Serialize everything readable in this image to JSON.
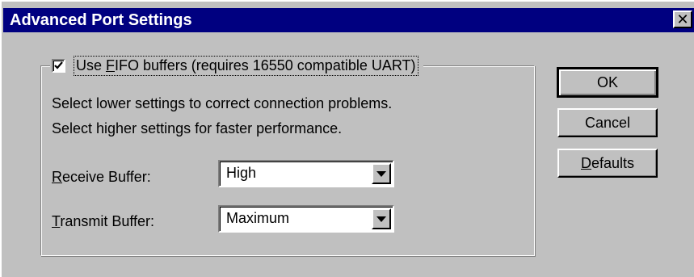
{
  "window": {
    "title": "Advanced Port Settings",
    "close_glyph": "✕"
  },
  "fifo": {
    "checked": true,
    "label_prefix": "Use ",
    "label_mnemonic": "F",
    "label_suffix": "IFO buffers (requires 16550 compatible UART)"
  },
  "description": {
    "line1": "Select lower settings to correct connection problems.",
    "line2": "Select higher settings for faster performance."
  },
  "receive": {
    "label_mnemonic": "R",
    "label_rest": "eceive Buffer:",
    "value": "High"
  },
  "transmit": {
    "label_mnemonic": "T",
    "label_rest": "ransmit Buffer:",
    "value": "Maximum"
  },
  "buttons": {
    "ok": "OK",
    "cancel": "Cancel",
    "defaults_mnemonic": "D",
    "defaults_rest": "efaults"
  },
  "colors": {
    "face": "#c0c0c0",
    "titlebar": "#000080",
    "shadow": "#808080",
    "highlight": "#ffffff"
  }
}
